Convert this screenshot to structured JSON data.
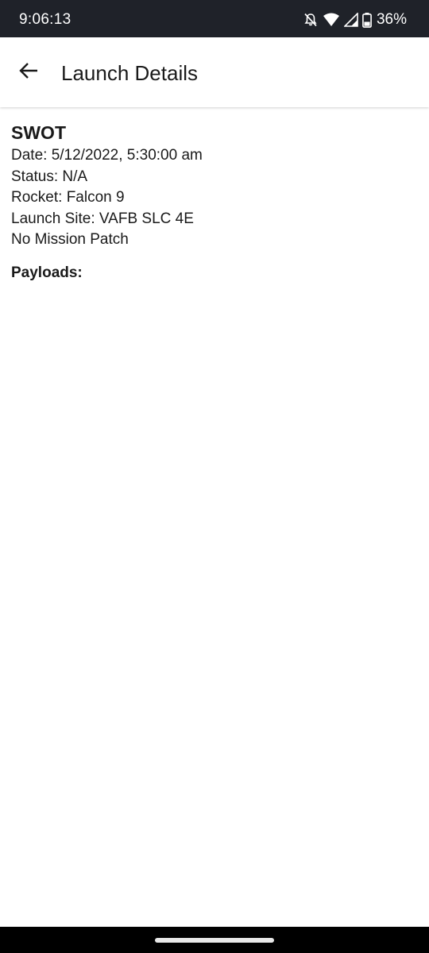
{
  "status_bar": {
    "time": "9:06:13",
    "battery_percent": "36%",
    "icons": [
      "bell-off-icon",
      "wifi-icon",
      "signal-icon",
      "battery-icon"
    ]
  },
  "app_bar": {
    "title": "Launch Details",
    "back_icon": "arrow-left-icon"
  },
  "launch": {
    "mission_name": "SWOT",
    "date_line": "Date: 5/12/2022, 5:30:00 am",
    "status_line": "Status: N/A",
    "rocket_line": "Rocket: Falcon 9",
    "launch_site_line": "Launch Site: VAFB SLC 4E",
    "patch_line": "No Mission Patch",
    "payloads_label": "Payloads:"
  },
  "colors": {
    "status_bar_bg": "#1f2229",
    "text": "#1a1a1a",
    "background": "#ffffff"
  }
}
